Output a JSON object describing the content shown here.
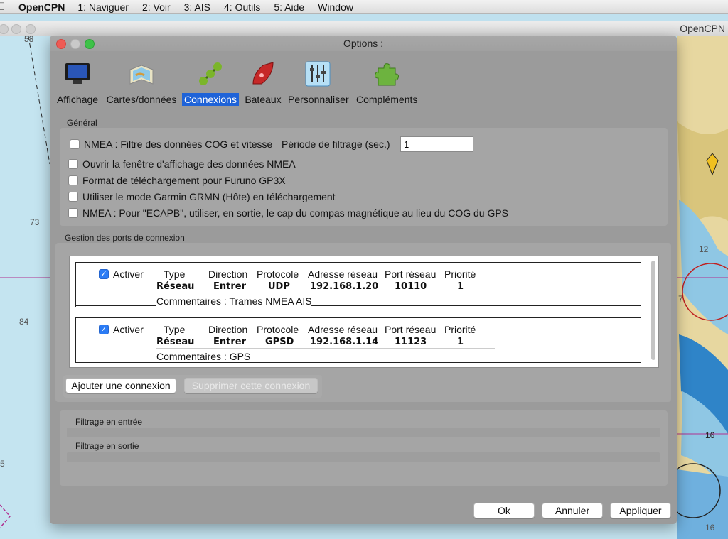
{
  "menubar": {
    "app_name": "OpenCPN",
    "items": [
      "1: Naviguer",
      "2: Voir",
      "3: AIS",
      "4: Outils",
      "5: Aide",
      "Window"
    ]
  },
  "background_window": {
    "title": "OpenCPN"
  },
  "chart_labels": {
    "depth_1": "58",
    "depth_2": "73",
    "depth_3": "84",
    "depth_4": "12",
    "depth_5": "7",
    "depth_6": "16",
    "depth_7": "16",
    "depth_8": "5"
  },
  "dialog": {
    "title": "Options :",
    "tabs": [
      {
        "label": "Affichage",
        "icon": "monitor-icon"
      },
      {
        "label": "Cartes/données",
        "icon": "charts-icon"
      },
      {
        "label": "Connexions",
        "icon": "connections-icon",
        "active": true
      },
      {
        "label": "Bateaux",
        "icon": "boat-icon"
      },
      {
        "label": "Personnaliser",
        "icon": "sliders-icon"
      },
      {
        "label": "Compléments",
        "icon": "puzzle-icon"
      }
    ],
    "general": {
      "title": "Général",
      "cog_filter_label": "NMEA : Filtre des données COG et vitesse",
      "filter_period_label": "Période de filtrage (sec.)",
      "filter_period_value": "1",
      "options": [
        {
          "label": "Ouvrir la fenêtre d'affichage des données NMEA",
          "checked": false
        },
        {
          "label": "Format de téléchargement pour Furuno GP3X",
          "checked": false
        },
        {
          "label": "Utiliser le mode Garmin GRMN (Hôte) en téléchargement",
          "checked": false
        },
        {
          "label": "NMEA : Pour \"ECAPB\", utiliser, en sortie, le cap du compas magnétique  au lieu du COG du GPS",
          "checked": false
        }
      ]
    },
    "ports": {
      "title": "Gestion des ports de connexion",
      "headers": {
        "activate": "Activer",
        "type": "Type",
        "direction": "Direction",
        "protocol": "Protocole",
        "address": "Adresse réseau",
        "port": "Port réseau",
        "priority": "Priorité"
      },
      "connections": [
        {
          "enabled": true,
          "type": "Réseau",
          "direction": "Entrer",
          "protocol": "UDP",
          "address": "192.168.1.20",
          "port": "10110",
          "priority": "1",
          "comment": "Commentaires : Trames NMEA AIS"
        },
        {
          "enabled": true,
          "type": "Réseau",
          "direction": "Entrer",
          "protocol": "GPSD",
          "address": "192.168.1.14",
          "port": "11123",
          "priority": "1",
          "comment": "Commentaires : GPS"
        }
      ],
      "add_button": "Ajouter une connexion",
      "remove_button": "Supprimer cette connexion"
    },
    "filters": {
      "input_label": "Filtrage en entrée",
      "output_label": "Filtrage en sortie"
    },
    "buttons": {
      "ok": "Ok",
      "cancel": "Annuler",
      "apply": "Appliquer"
    }
  },
  "colors": {
    "accent": "#1f63d8",
    "checkbox": "#2b7cf5",
    "dialog_bg": "#9b9b9b"
  }
}
